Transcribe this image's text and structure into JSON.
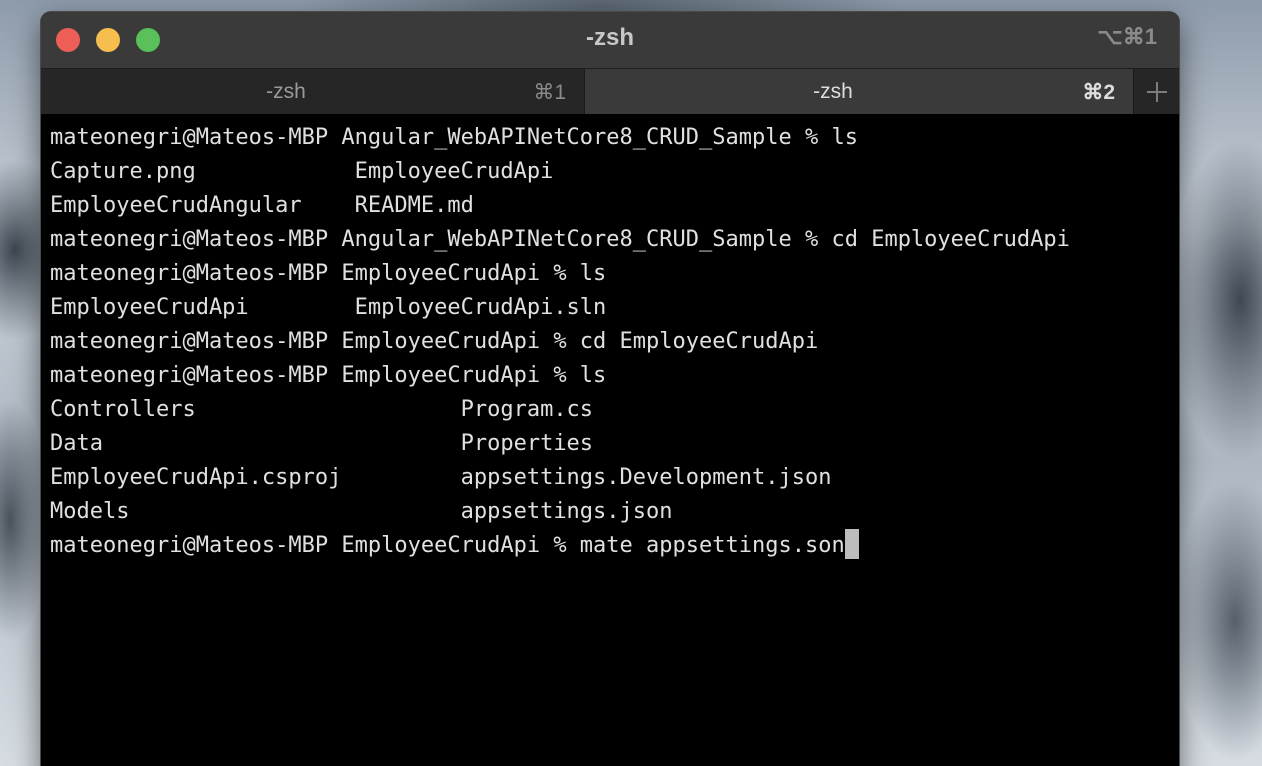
{
  "window": {
    "title": "-zsh",
    "shortcut": "⌥⌘1"
  },
  "tabs": [
    {
      "label": "-zsh",
      "shortcut": "⌘1",
      "active": false
    },
    {
      "label": "-zsh",
      "shortcut": "⌘2",
      "active": true
    }
  ],
  "new_tab_icon": "plus-icon",
  "terminal": {
    "lines": [
      "mateonegri@Mateos-MBP Angular_WebAPINetCore8_CRUD_Sample % ls",
      "Capture.png            EmployeeCrudApi",
      "EmployeeCrudAngular    README.md",
      "mateonegri@Mateos-MBP Angular_WebAPINetCore8_CRUD_Sample % cd EmployeeCrudApi",
      "mateonegri@Mateos-MBP EmployeeCrudApi % ls",
      "EmployeeCrudApi        EmployeeCrudApi.sln",
      "mateonegri@Mateos-MBP EmployeeCrudApi % cd EmployeeCrudApi",
      "mateonegri@Mateos-MBP EmployeeCrudApi % ls",
      "Controllers                    Program.cs",
      "Data                           Properties",
      "EmployeeCrudApi.csproj         appsettings.Development.json",
      "Models                         appsettings.json",
      "mateonegri@Mateos-MBP EmployeeCrudApi % mate appsettings.son"
    ]
  },
  "colors": {
    "terminal_bg": "#000000",
    "terminal_fg": "#e0e0e0",
    "close": "#ed5f57",
    "minimize": "#f5be4f",
    "maximize": "#5ac05a"
  }
}
